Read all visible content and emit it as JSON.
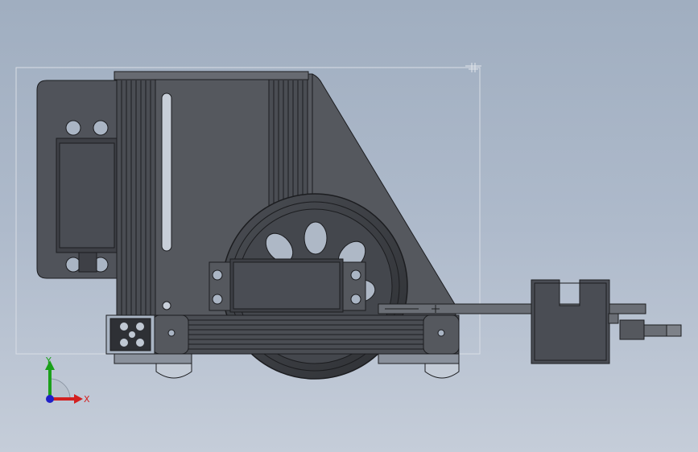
{
  "viewport": {
    "background_top": "#a0aec0",
    "background_bottom": "#c5cdd9"
  },
  "model": {
    "part_color": "#55585e",
    "part_dark": "#3a3c41",
    "edge_color": "#1c1d20",
    "highlight": "#7e8289"
  },
  "triad": {
    "x_label": "X",
    "y_label": "Y",
    "x_color": "#d32020",
    "y_color": "#1aa01a",
    "z_color": "#2020c8"
  },
  "icons": [
    "view-triad-icon",
    "origin-marker-icon"
  ]
}
